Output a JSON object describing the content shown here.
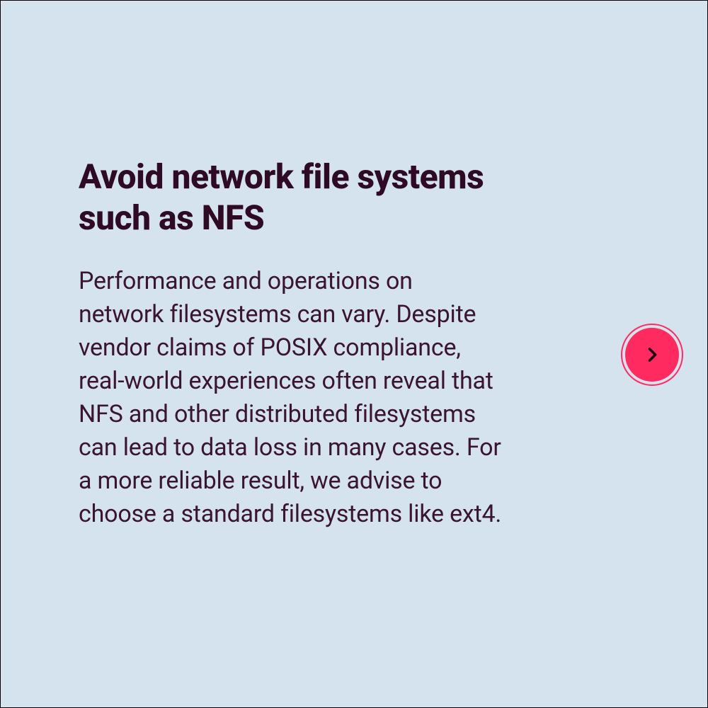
{
  "card": {
    "heading": "Avoid network file systems such as NFS",
    "body": "Performance and operations on network filesystems can vary. Despite vendor claims of POSIX compliance, real-world experiences often reveal that NFS and other distributed filesystems can lead to data loss in many cases. For a more reliable result, we advise to choose a standard filesystems like ext4."
  },
  "colors": {
    "background": "#d5e3ef",
    "text": "#2e0a25",
    "accent": "#ff2a5f"
  }
}
